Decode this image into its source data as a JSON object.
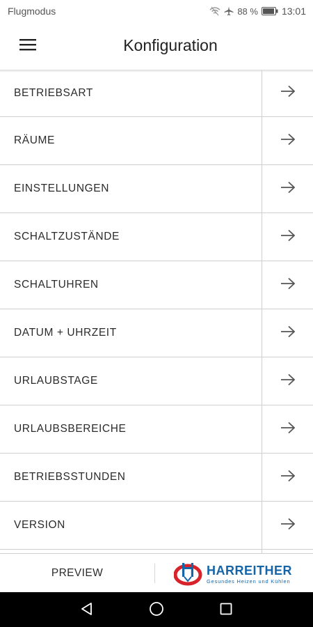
{
  "status_bar": {
    "left_text": "Flugmodus",
    "battery": "88 %",
    "time": "13:01"
  },
  "header": {
    "title": "Konfiguration"
  },
  "menu": {
    "items": [
      {
        "label": "BETRIEBSART"
      },
      {
        "label": "RÄUME"
      },
      {
        "label": "EINSTELLUNGEN"
      },
      {
        "label": "SCHALTZUSTÄNDE"
      },
      {
        "label": "SCHALTUHREN"
      },
      {
        "label": "DATUM + UHRZEIT"
      },
      {
        "label": "URLAUBSTAGE"
      },
      {
        "label": "URLAUBSBEREICHE"
      },
      {
        "label": "BETRIEBSSTUNDEN"
      },
      {
        "label": "VERSION"
      },
      {
        "label": ""
      }
    ]
  },
  "bottom_bar": {
    "preview_label": "PREVIEW",
    "brand_name": "HARREITHER",
    "brand_tagline": "Gesundes Heizen und Kühlen"
  },
  "colors": {
    "brand_blue": "#1565a8",
    "brand_red": "#d8232a",
    "divider": "#cfcfcf"
  },
  "icons": {
    "menu": "hamburger-icon",
    "row_arrow": "arrow-right-icon",
    "nav_back": "back-triangle-icon",
    "nav_home": "home-circle-icon",
    "nav_recent": "recent-square-icon"
  }
}
